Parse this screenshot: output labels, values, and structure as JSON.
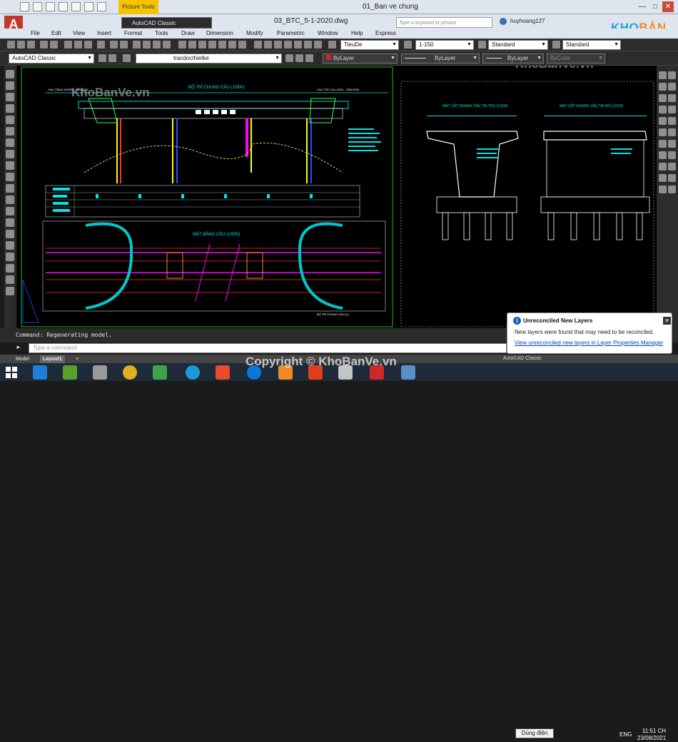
{
  "window": {
    "title": "01_Ban ve chung",
    "document_title": "03_BTC_5-1-2020.dwg",
    "picture_tools": "Picture Tools",
    "search_placeholder": "Type a keyword or phrase",
    "user": "huyhoang127",
    "workspace": "AutoCAD Classic"
  },
  "menus": [
    "File",
    "Edit",
    "View",
    "Insert",
    "Format",
    "Tools",
    "Draw",
    "Dimension",
    "Modify",
    "Parametric",
    "Window",
    "Help",
    "Express"
  ],
  "toolbar": {
    "workspace_combo": "AutoCAD Classic",
    "text_style": "TieuDe",
    "dim_scale": "1-150",
    "dim_style": "Standard",
    "table_style": "Standard",
    "layer": "tracdocthietke",
    "color": "ByLayer",
    "linetype": "ByLayer",
    "lineweight": "ByLayer",
    "plotstyle": "ByColor"
  },
  "drawing": {
    "title_left": "BỐ TRÍ CHUNG CẦU (1/500)",
    "title_plan": "MẶT BẰNG CẦU (1/500)",
    "title_section_pier": "MẶT CẮT NGANG CẦU TẠI TRỤ (1/150)",
    "title_section_abut": "MẶT CẮT NGANG CẦU TẠI MỐ (1/150)",
    "note_top_left": "KM: CÔNG NGHĨA - VẬN ĐỒN",
    "note_top_right": "CAO TỐC HẠ LONG - VÂN ĐỒN",
    "plan_caption": "BỐ TRÍ CHUNG CẦU (1)"
  },
  "command": {
    "history": "Command: Regenerating model.",
    "placeholder": "Type a command"
  },
  "status_tabs": [
    "Model",
    "Layout1",
    "+"
  ],
  "workspace_status": "AutoCAD Classic",
  "notification": {
    "title": "Unreconciled New Layers",
    "message": "New layers were found that may need to be reconciled.",
    "link": "View unreconciled new layers in Layer Properties Manager"
  },
  "taskbar": {
    "tooltip": "Dùng điện",
    "language": "ENG",
    "time": "11:51 CH",
    "date": "23/08/2021"
  },
  "watermarks": {
    "logo_kho": "KHO",
    "logo_banve": "BẢN VẼ",
    "text": "KhoBanVe.vn",
    "copyright": "Copyright © KhoBanVe.vn"
  }
}
